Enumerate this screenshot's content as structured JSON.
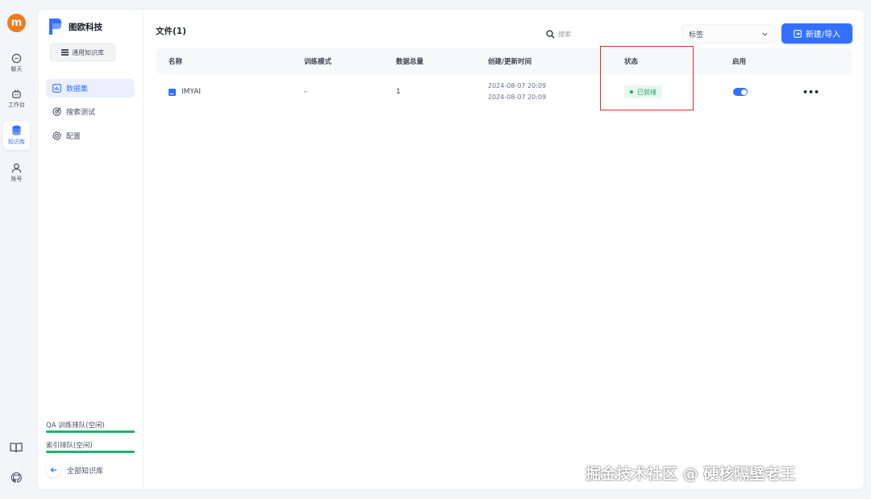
{
  "rail": {
    "avatar_letter": "m",
    "items": [
      {
        "label": "聊天",
        "icon": "chat-icon"
      },
      {
        "label": "工作台",
        "icon": "robot-icon"
      },
      {
        "label": "知识库",
        "icon": "database-icon"
      },
      {
        "label": "账号",
        "icon": "user-icon"
      }
    ],
    "bottom_icons": [
      "book-icon",
      "github-icon"
    ]
  },
  "sidebar": {
    "brand": "图欧科技",
    "type_tag": "通用知识库",
    "nav": [
      {
        "label": "数据集",
        "icon": "dataset-icon"
      },
      {
        "label": "搜索测试",
        "icon": "search-test-icon"
      },
      {
        "label": "配置",
        "icon": "gear-icon"
      }
    ],
    "queues": [
      "QA 训练排队(空闲)",
      "索引排队(空闲)"
    ],
    "back_label": "全部知识库"
  },
  "header": {
    "files_title": "文件(1)",
    "search_placeholder": "搜索",
    "tag_select": "标签",
    "new_button": "新建/导入"
  },
  "table": {
    "columns": [
      "名称",
      "训练模式",
      "数据总量",
      "创建/更新时间",
      "状态",
      "启用"
    ],
    "rows": [
      {
        "name": "IMYAI",
        "mode": "-",
        "count": "1",
        "created": "2024-08-07 20:09",
        "updated": "2024-08-07 20:09",
        "status": "已就绪",
        "enabled": true,
        "more": "•••"
      }
    ]
  },
  "colors": {
    "accent": "#3370ff",
    "status_green": "#20a663",
    "highlight_red": "#e0282e",
    "avatar_orange": "#ee7c1b"
  },
  "watermark": "掘金技术社区 @ 硬核隔壁老王"
}
